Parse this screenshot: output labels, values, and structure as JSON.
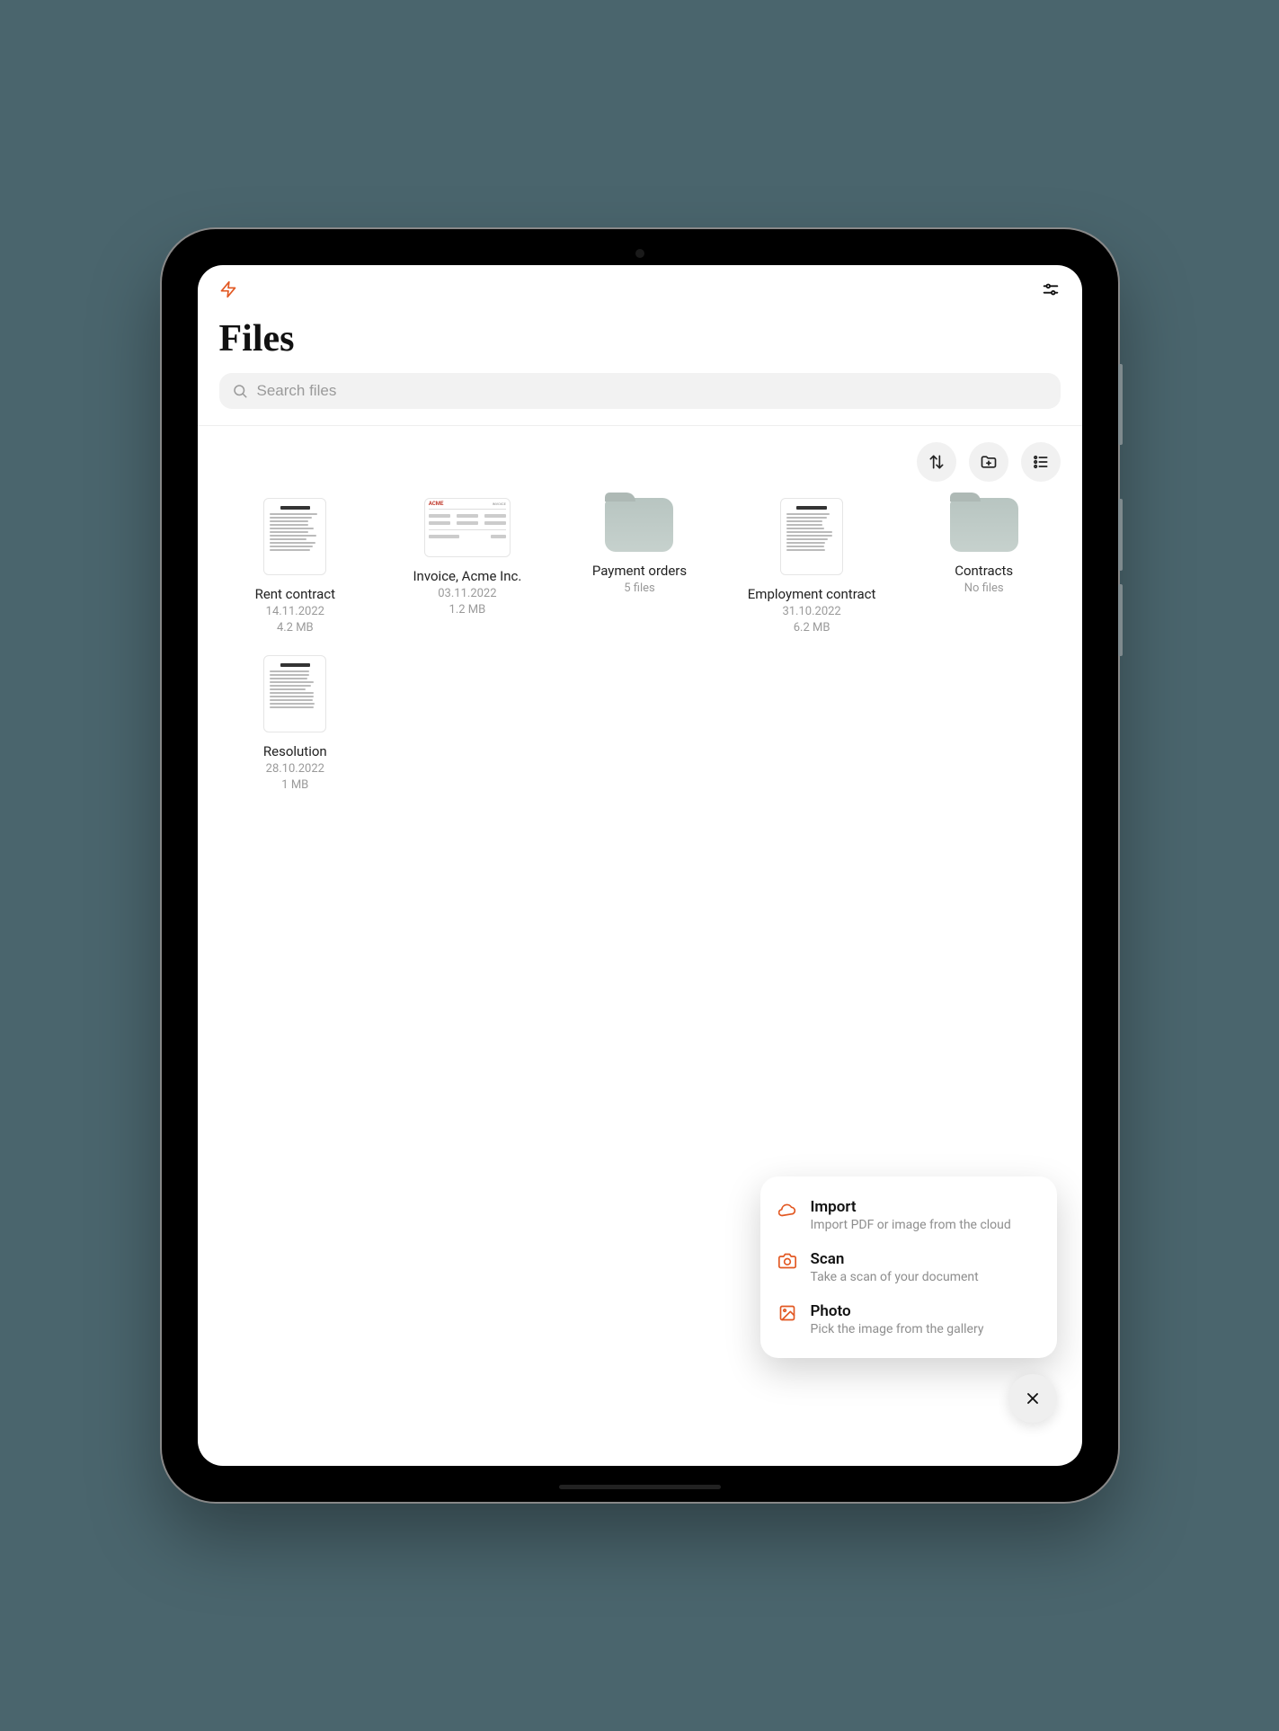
{
  "page_title": "Files",
  "search": {
    "placeholder": "Search files",
    "value": ""
  },
  "items": [
    {
      "type": "file",
      "name": "Rent contract",
      "date": "14.11.2022",
      "size": "4.2 MB"
    },
    {
      "type": "file",
      "name": "Invoice, Acme Inc.",
      "date": "03.11.2022",
      "size": "1.2 MB",
      "variant": "invoice"
    },
    {
      "type": "folder",
      "name": "Payment orders",
      "count": "5 files"
    },
    {
      "type": "file",
      "name": "Employment contract",
      "date": "31.10.2022",
      "size": "6.2 MB"
    },
    {
      "type": "folder",
      "name": "Contracts",
      "count": "No files"
    },
    {
      "type": "file",
      "name": "Resolution",
      "date": "28.10.2022",
      "size": "1 MB"
    }
  ],
  "popover": {
    "items": [
      {
        "icon": "cloud",
        "title": "Import",
        "desc": "Import PDF or image from the cloud"
      },
      {
        "icon": "camera",
        "title": "Scan",
        "desc": "Take a scan of your document"
      },
      {
        "icon": "image",
        "title": "Photo",
        "desc": "Pick the image from the gallery"
      }
    ]
  },
  "icons": {
    "bolt": "bolt-icon",
    "settings": "sliders-icon",
    "sort": "sort-icon",
    "add_folder": "add-folder-icon",
    "list": "list-icon",
    "close": "close-icon",
    "search": "search-icon"
  },
  "colors": {
    "accent": "#e25822",
    "muted": "#9a9a9a",
    "bg": "#4a656d"
  }
}
